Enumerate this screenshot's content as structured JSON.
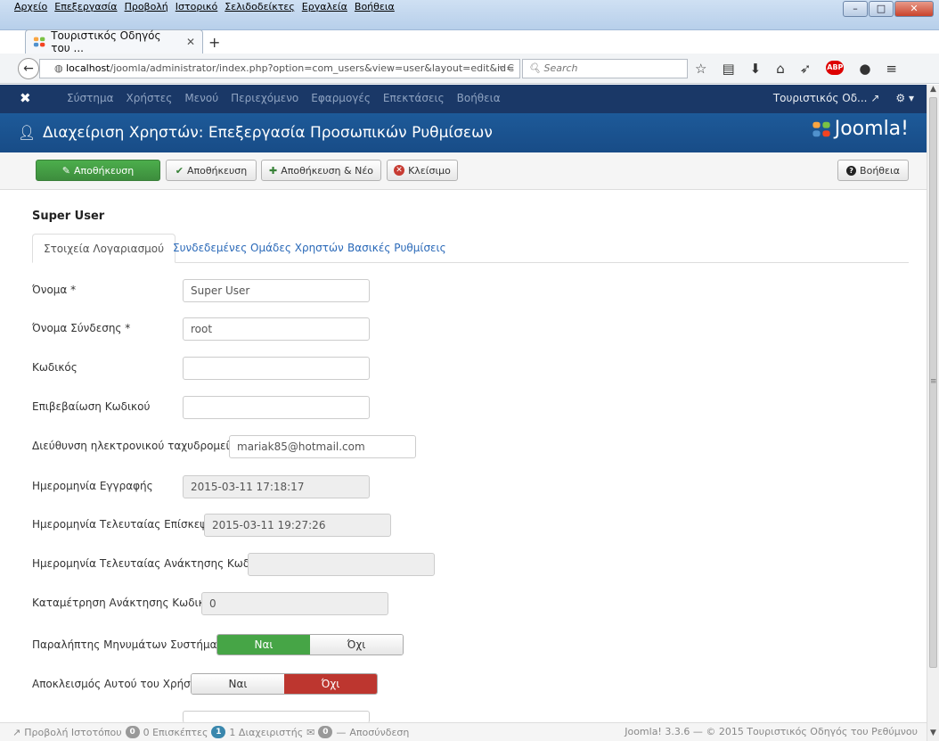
{
  "browser": {
    "menu": [
      "Αρχείο",
      "Επεξεργασία",
      "Προβολή",
      "Ιστορικό",
      "Σελιδοδείκτες",
      "Εργαλεία",
      "Βοήθεια"
    ],
    "tab_title": "Τουριστικός Οδηγός του ...",
    "url_host": "localhost",
    "url_path": "/joomla/administrator/index.php?option=com_users&view=user&layout=edit&id=",
    "search_placeholder": "Search"
  },
  "admin_nav": {
    "items": [
      "Σύστημα",
      "Χρήστες",
      "Μενού",
      "Περιεχόμενο",
      "Εφαρμογές",
      "Επεκτάσεις",
      "Βοήθεια"
    ],
    "site_link": "Τουριστικός Οδ..."
  },
  "header": {
    "title": "Διαχείριση Χρηστών: Επεξεργασία Προσωπικών Ρυθμίσεων",
    "brand": "Joomla!"
  },
  "toolbar": {
    "save": "Αποθήκευση",
    "save_close": "Αποθήκευση",
    "save_new": "Αποθήκευση & Νέο",
    "close": "Κλείσιμο",
    "help": "Βοήθεια"
  },
  "user": {
    "display_name": "Super User"
  },
  "tabs": [
    "Στοιχεία Λογαριασμού",
    "Συνδεδεμένες Ομάδες Χρηστών",
    "Βασικές Ρυθμίσεις"
  ],
  "form": {
    "name_label": "Όνομα *",
    "name_value": "Super User",
    "login_label": "Όνομα Σύνδεσης *",
    "login_value": "root",
    "password_label": "Κωδικός",
    "password2_label": "Επιβεβαίωση Κωδικού",
    "email_label": "Διεύθυνση ηλεκτρονικού ταχυδρομείου *",
    "email_value": "mariak85@hotmail.com",
    "register_label": "Ημερομηνία Εγγραφής",
    "register_value": "2015-03-11 17:18:17",
    "lastvisit_label": "Ημερομηνία Τελευταίας Επίσκεψης",
    "lastvisit_value": "2015-03-11 19:27:26",
    "lastreset_label": "Ημερομηνία Τελευταίας Ανάκτησης Κωδικού",
    "resetcount_label": "Καταμέτρηση Ανάκτησης Κωδικού",
    "resetcount_value": "0",
    "sysemail_label": "Παραλήπτης Μηνυμάτων Συστήματος",
    "block_label": "Αποκλεισμός Αυτού του Χρήστη",
    "yes": "Ναι",
    "no": "Όχι",
    "sysemail_selected": "yes",
    "block_selected": "no"
  },
  "status": {
    "view_site": "Προβολή Ιστοτόπου",
    "visitors_count": "0",
    "visitors_label": "0 Επισκέπτες",
    "admins_count": "1",
    "admins_label": "1 Διαχειριστής",
    "messages_count": "0",
    "logout": "Αποσύνδεση",
    "footer": "Joomla! 3.3.6 — © 2015 Τουριστικός Οδηγός του Ρεθύμνου"
  },
  "colors": {
    "nav_bg": "#1a3867",
    "header_bg": "#1d5a99",
    "success": "#46a546",
    "danger": "#bd362f",
    "link": "#2a69b8"
  }
}
